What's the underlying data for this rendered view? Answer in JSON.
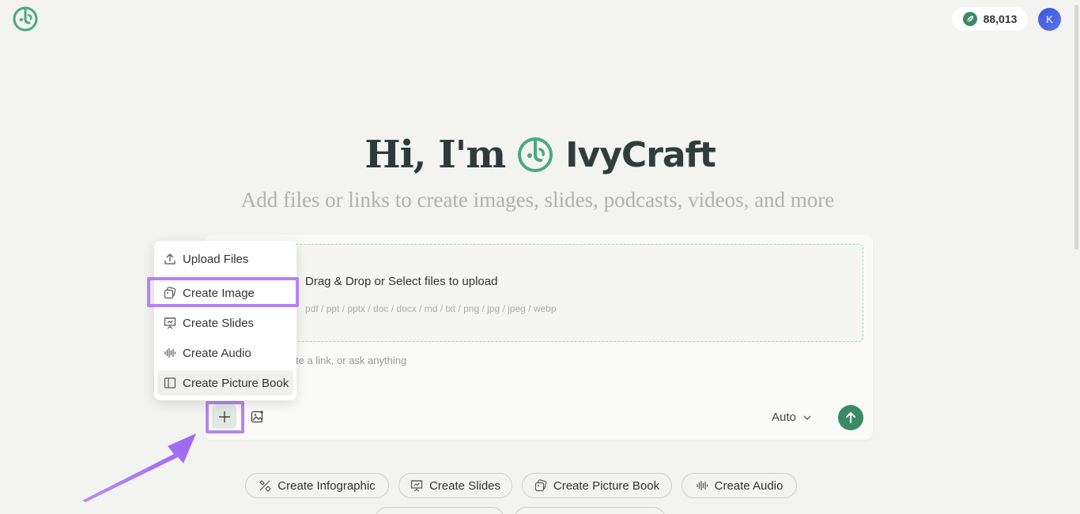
{
  "header": {
    "logo_icon": "ivycraft-logo-icon",
    "credits": "88,013",
    "credits_icon": "leaf-icon",
    "avatar_initial": "K"
  },
  "hero": {
    "greeting": "Hi, I'm",
    "brand": "IvyCraft",
    "subtitle": "Add files or links to create images, slides, podcasts, videos, and more"
  },
  "composer": {
    "dropzone_title": "Drag & Drop or Select files to upload",
    "dropzone_types": "pdf / ppt / pptx / doc / docx / md / txt / png / jpg / jpeg / webp",
    "prompt_placeholder": "te a link, or ask anything",
    "model": "Auto",
    "send_icon": "arrow-up-icon"
  },
  "menu": {
    "items": [
      {
        "label": "Upload Files",
        "icon": "upload-icon"
      },
      {
        "label": "Create Image",
        "icon": "image-icon"
      },
      {
        "label": "Create Slides",
        "icon": "slides-icon"
      },
      {
        "label": "Create Audio",
        "icon": "audio-wave-icon"
      },
      {
        "label": "Create Picture Book",
        "icon": "book-icon"
      }
    ]
  },
  "chips": [
    {
      "label": "Create Infographic",
      "icon": "infographic-icon"
    },
    {
      "label": "Create Slides",
      "icon": "slides-icon"
    },
    {
      "label": "Create Picture Book",
      "icon": "picture-book-icon"
    },
    {
      "label": "Create Audio",
      "icon": "audio-wave-icon"
    }
  ],
  "colors": {
    "accent": "#3a8a63",
    "highlight": "#b583f2",
    "background": "#f3f3f2"
  }
}
